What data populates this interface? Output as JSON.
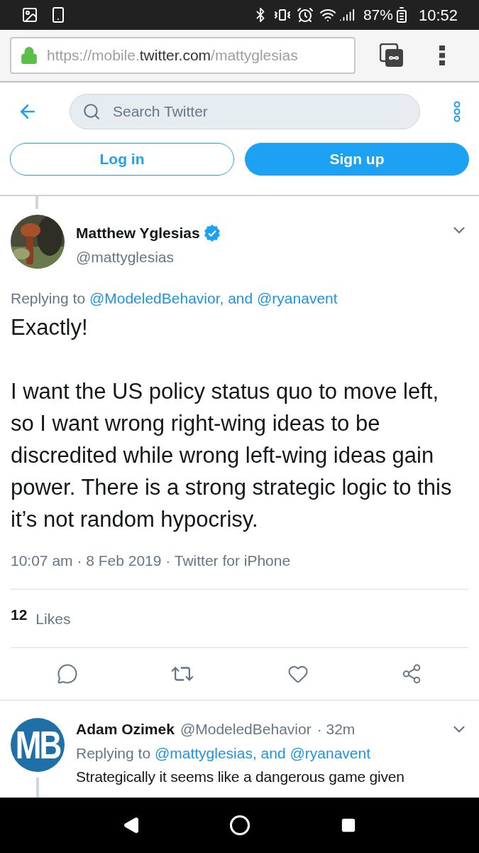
{
  "status_bar": {
    "battery": "87%",
    "time": "10:52"
  },
  "browser": {
    "url_prefix": "https://mobile.",
    "url_domain": "twitter.com",
    "url_path": "/mattyglesias"
  },
  "header": {
    "search": {
      "placeholder": "Search Twitter"
    },
    "buttons": [
      {
        "label": "Log in",
        "kind": "outline"
      },
      {
        "label": "Sign up",
        "kind": "filled"
      }
    ]
  },
  "tweet": {
    "name": "Matthew Yglesias",
    "verified": true,
    "handle": "@mattyglesias",
    "replying_prefix": "Replying to",
    "replying_to": "@ModeledBehavior, and @ryanavent",
    "paragraphs": [
      "Exactly!",
      "I want the US policy status quo to move left, so I want wrong right-wing ideas to be discredited while wrong left-wing ideas gain power. There is a strong strategic logic to this it’s not random hypocrisy."
    ],
    "meta": "10:07 am · 8 Feb 2019 · Twitter for iPhone",
    "likes_count": "12",
    "likes_label": "Likes"
  },
  "reply": {
    "avatar_text": "MB",
    "name": "Adam Ozimek",
    "handle": "@ModeledBehavior",
    "time": "· 32m",
    "replying_prefix": "Replying to",
    "replying_to": "@mattyglesias, and @ryanavent",
    "text": "Strategically it seems like a dangerous game given"
  }
}
